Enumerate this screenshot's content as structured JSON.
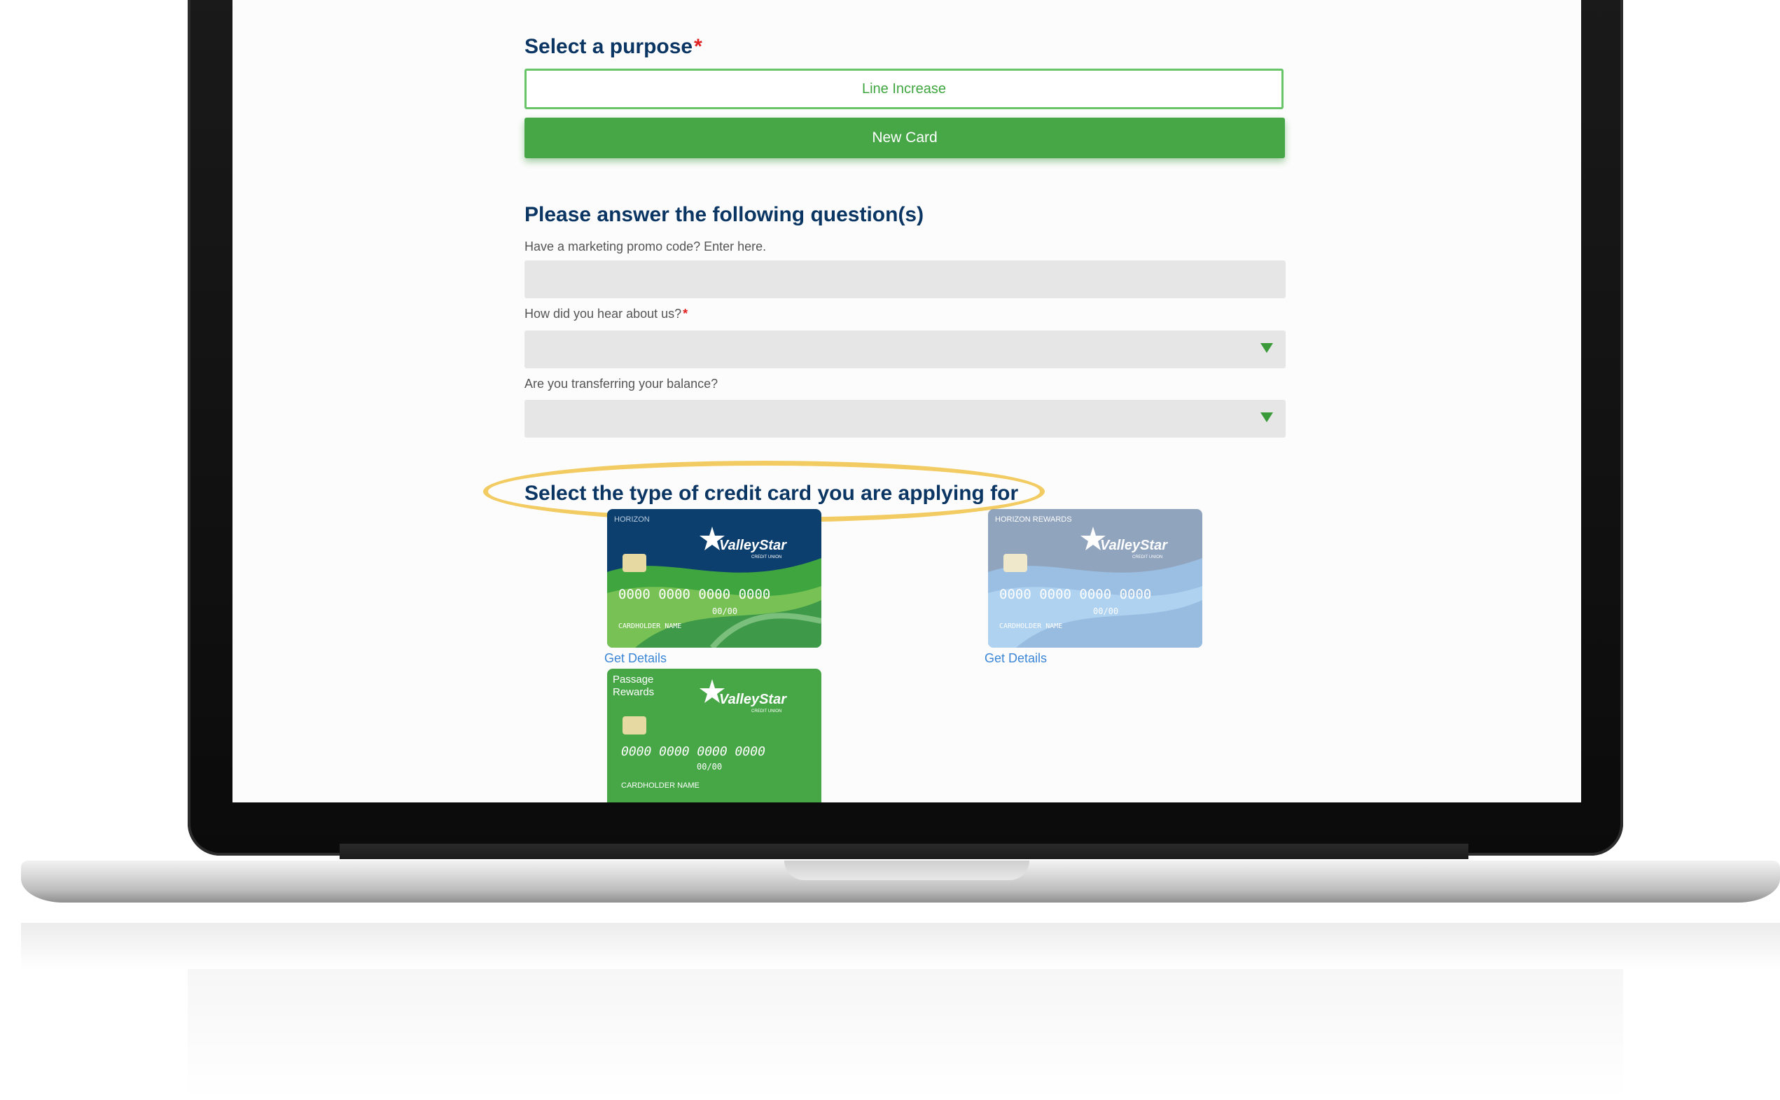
{
  "form": {
    "purpose_heading": "Select a purpose",
    "required_mark": "*",
    "purpose_options": [
      "Line Increase",
      "New Card"
    ],
    "questions_heading": "Please answer the following question(s)",
    "promo_label": "Have a marketing promo code? Enter here.",
    "promo_value": "",
    "hear_label": "How did you hear about us?",
    "hear_value": "",
    "transfer_label": "Are you transferring your balance?",
    "transfer_value": "",
    "card_type_heading": "Select the type of credit card you are applying for"
  },
  "cards": [
    {
      "top_label": "HORIZON",
      "brand": "ValleyStar",
      "brand_sub": "CREDIT UNION",
      "number": "0000 0000 0000 0000",
      "expiry": "00/00",
      "holder": "CARDHOLDER NAME",
      "link": "Get Details"
    },
    {
      "top_label": "HORIZON REWARDS",
      "brand": "ValleyStar",
      "brand_sub": "CREDIT UNION",
      "number": "0000 0000 0000 0000",
      "expiry": "00/00",
      "holder": "CARDHOLDER NAME",
      "link": "Get Details"
    },
    {
      "top_label_1": "Passage",
      "top_label_2": "Rewards",
      "brand": "ValleyStar",
      "brand_sub": "CREDIT UNION",
      "number": "0000  0000  0000  0000",
      "expiry": "00/00",
      "holder": "CARDHOLDER NAME"
    }
  ],
  "colors": {
    "heading": "#0b3663",
    "accent_green": "#47a747",
    "link_blue": "#3a86d6",
    "highlight": "#f2cc62"
  }
}
